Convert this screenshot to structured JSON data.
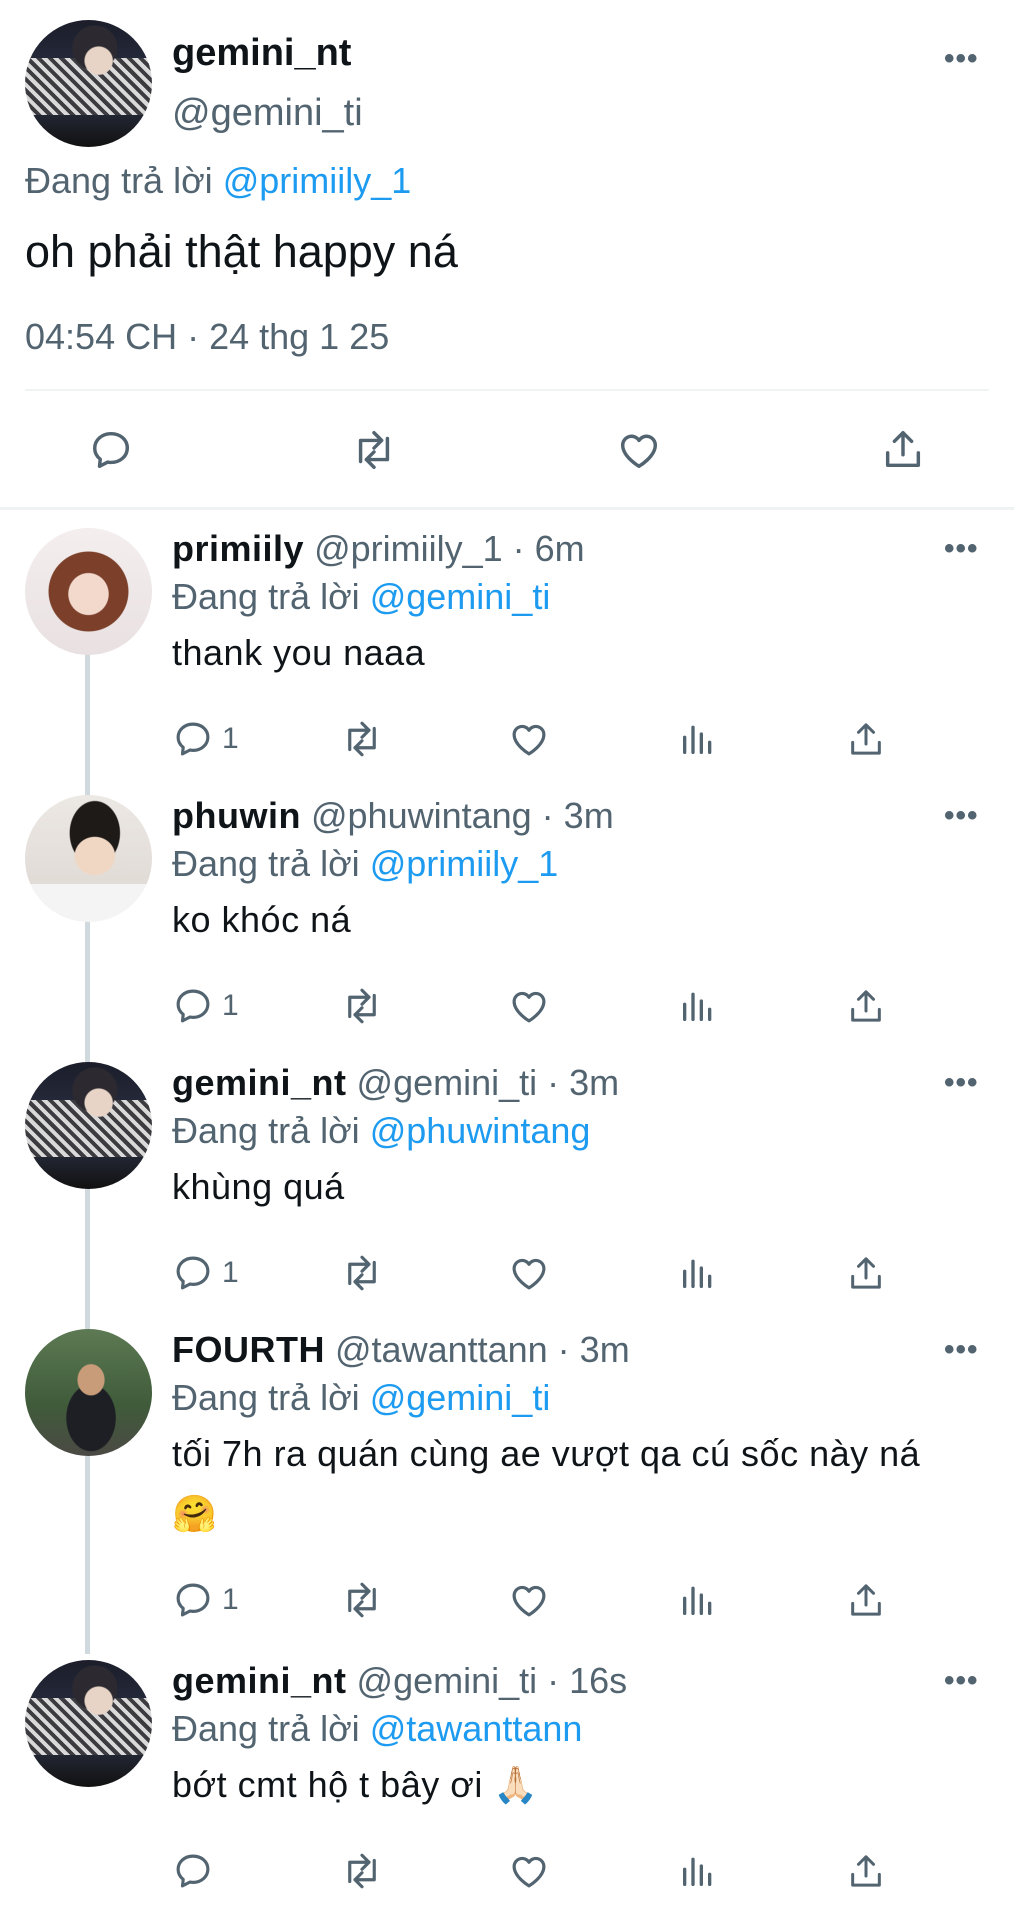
{
  "main_tweet": {
    "display_name": "gemini_nt",
    "handle": "@gemini_ti",
    "reply_prefix": "Đang trả lời",
    "reply_to": "@primiily_1",
    "text": "oh phải thật happy ná",
    "timestamp": "04:54 CH · 24 thg 1 25",
    "more_label": "•••"
  },
  "replies": [
    {
      "display_name": "primiily",
      "meta": "@primiily_1 · 6m",
      "reply_prefix": "Đang trả lời",
      "reply_to": "@gemini_ti",
      "text": "thank you naaa",
      "reply_count": "1",
      "more_label": "•••"
    },
    {
      "display_name": "phuwin",
      "meta": "@phuwintang · 3m",
      "reply_prefix": "Đang trả lời",
      "reply_to": "@primiily_1",
      "text": "ko khóc ná",
      "reply_count": "1",
      "more_label": "•••"
    },
    {
      "display_name": "gemini_nt",
      "meta": "@gemini_ti · 3m",
      "reply_prefix": "Đang trả lời",
      "reply_to": "@phuwintang",
      "text": "khùng quá",
      "reply_count": "1",
      "more_label": "•••"
    },
    {
      "display_name": "FOURTH",
      "meta": "@tawanttann · 3m",
      "reply_prefix": "Đang trả lời",
      "reply_to": "@gemini_ti",
      "text": "tối 7h ra quán cùng ae vượt qa cú sốc này ná",
      "text_line2": "🤗",
      "reply_count": "1",
      "more_label": "•••"
    },
    {
      "display_name": "gemini_nt",
      "meta": "@gemini_ti · 16s",
      "reply_prefix": "Đang trả lời",
      "reply_to": "@tawanttann",
      "text": "bớt cmt hộ t bây ơi 🙏🏻",
      "reply_count": "",
      "more_label": "•••"
    }
  ],
  "icons": [
    "reply-icon",
    "retweet-icon",
    "like-icon",
    "views-icon",
    "share-icon",
    "more-icon"
  ],
  "colors": {
    "link": "#1d9bf0",
    "secondary": "#536471",
    "text": "#0f1419",
    "divider": "#eff3f4"
  }
}
